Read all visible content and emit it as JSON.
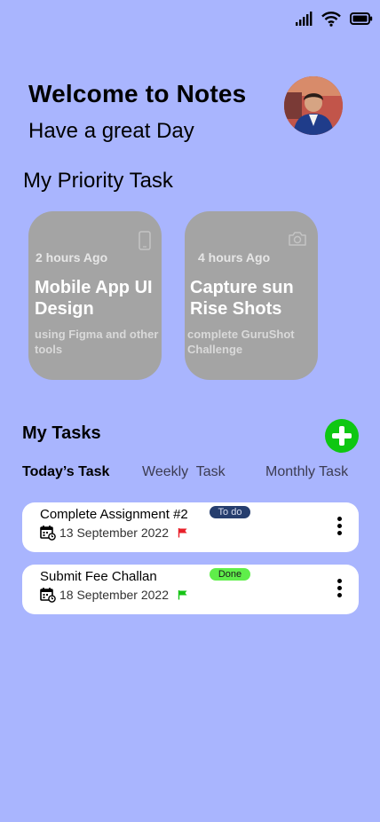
{
  "status_bar": {
    "signal_icon": "signal-icon",
    "wifi_icon": "wifi-icon",
    "battery_icon": "battery-icon"
  },
  "header": {
    "title": "Welcome to Notes",
    "subtitle": "Have a great Day",
    "avatar_icon": "avatar"
  },
  "priority": {
    "title": "My Priority Task",
    "cards": [
      {
        "time": "2 hours Ago",
        "title": "Mobile App UI Design",
        "description": "using Figma and other tools",
        "icon": "mobile-phone-icon"
      },
      {
        "time": "4 hours Ago",
        "title": "Capture sun Rise Shots",
        "description": "complete GuruShot Challenge",
        "icon": "camera-icon"
      }
    ]
  },
  "tasks": {
    "title": "My Tasks",
    "add_icon": "plus-icon",
    "tabs": [
      {
        "label": "Today’s Task",
        "active": true
      },
      {
        "label": "Weekly  Task",
        "active": false
      },
      {
        "label": "Monthly Task",
        "active": false
      }
    ],
    "items": [
      {
        "name": "Complete Assignment #2",
        "date": "13 September 2022",
        "status": "To do",
        "flag_color": "#e8202a"
      },
      {
        "name": "Submit Fee Challan",
        "date": "18 September 2022",
        "status": "Done",
        "flag_color": "#17c417"
      }
    ]
  },
  "colors": {
    "background": "#a9b5fe",
    "card": "#a4a4a4",
    "accent_green": "#0fc712",
    "todo_badge": "#263e6e",
    "done_badge": "#5fee4a"
  }
}
